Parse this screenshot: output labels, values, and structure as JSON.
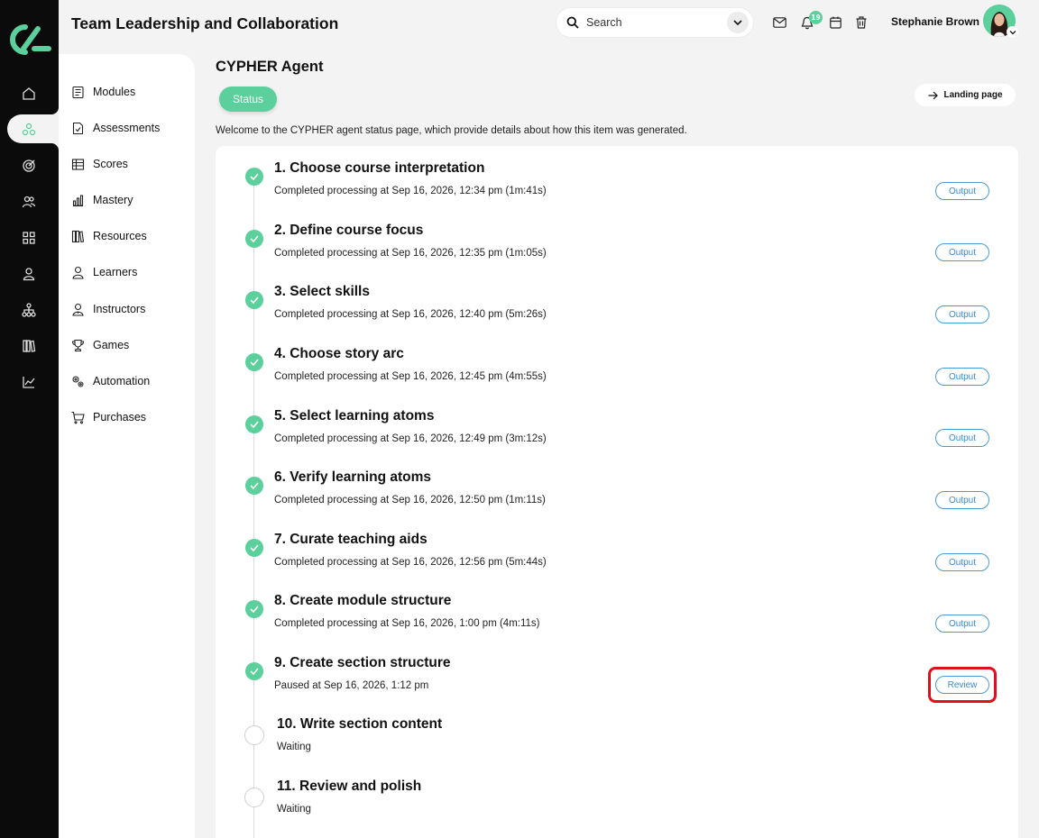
{
  "header": {
    "app_title": "Team Leadership and Collaboration",
    "search_placeholder": "Search",
    "notification_count": "19",
    "user_name": "Stephanie Brown"
  },
  "rail": {
    "icons": [
      "home-icon",
      "network-icon",
      "target-icon",
      "people-icon",
      "grid-icon",
      "person-icon",
      "hierarchy-icon",
      "library-icon",
      "chart-icon"
    ],
    "active_index": 1
  },
  "subnav": {
    "items": [
      {
        "label": "Modules",
        "icon": "modules-icon"
      },
      {
        "label": "Assessments",
        "icon": "assessments-icon"
      },
      {
        "label": "Scores",
        "icon": "scores-icon"
      },
      {
        "label": "Mastery",
        "icon": "mastery-icon"
      },
      {
        "label": "Resources",
        "icon": "resources-icon"
      },
      {
        "label": "Learners",
        "icon": "learners-icon"
      },
      {
        "label": "Instructors",
        "icon": "instructors-icon"
      },
      {
        "label": "Games",
        "icon": "games-icon"
      },
      {
        "label": "Automation",
        "icon": "automation-icon"
      },
      {
        "label": "Purchases",
        "icon": "purchases-icon"
      }
    ]
  },
  "page": {
    "title": "CYPHER Agent",
    "status_tab": "Status",
    "landing_button": "Landing page",
    "intro": "Welcome to the CYPHER agent status page, which provide details about how this item was generated."
  },
  "colors": {
    "accent": "#5bcf9c",
    "link_blue": "#3a8ad0",
    "highlight_red": "#e0101a"
  },
  "steps": [
    {
      "title": "1. Choose course interpretation",
      "subtitle": "Completed processing at Sep 16, 2026, 12:34 pm (1m:41s)",
      "state": "done",
      "action": "Output"
    },
    {
      "title": "2. Define course focus",
      "subtitle": "Completed processing at Sep 16, 2026, 12:35 pm (1m:05s)",
      "state": "done",
      "action": "Output"
    },
    {
      "title": "3. Select skills",
      "subtitle": "Completed processing at Sep 16, 2026, 12:40 pm (5m:26s)",
      "state": "done",
      "action": "Output"
    },
    {
      "title": "4. Choose story arc",
      "subtitle": "Completed processing at Sep 16, 2026, 12:45 pm (4m:55s)",
      "state": "done",
      "action": "Output"
    },
    {
      "title": "5. Select learning atoms",
      "subtitle": "Completed processing at Sep 16, 2026, 12:49 pm (3m:12s)",
      "state": "done",
      "action": "Output"
    },
    {
      "title": "6. Verify learning atoms",
      "subtitle": "Completed processing at Sep 16, 2026, 12:50 pm (1m:11s)",
      "state": "done",
      "action": "Output"
    },
    {
      "title": "7. Curate teaching aids",
      "subtitle": "Completed processing at Sep 16, 2026, 12:56 pm (5m:44s)",
      "state": "done",
      "action": "Output"
    },
    {
      "title": "8. Create module structure",
      "subtitle": "Completed processing at Sep 16, 2026, 1:00 pm (4m:11s)",
      "state": "done",
      "action": "Output"
    },
    {
      "title": "9. Create section structure",
      "subtitle": "Paused at Sep 16, 2026, 1:12 pm",
      "state": "paused",
      "action": "Review"
    },
    {
      "title": "10. Write section content",
      "subtitle": "Waiting",
      "state": "waiting",
      "action": ""
    },
    {
      "title": "11. Review and polish",
      "subtitle": "Waiting",
      "state": "waiting",
      "action": ""
    }
  ]
}
